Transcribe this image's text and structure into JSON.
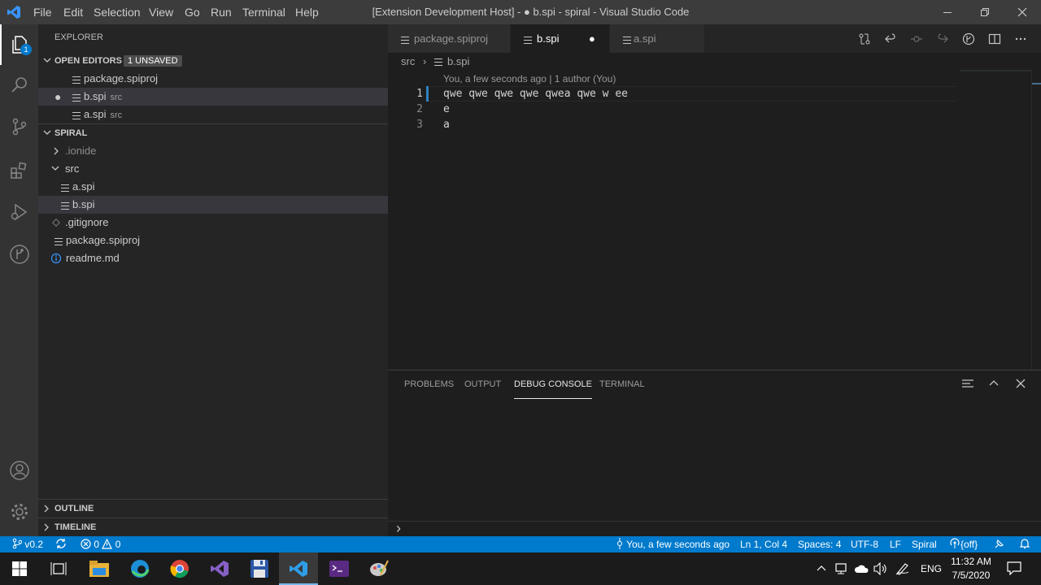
{
  "titlebar": {
    "menu": [
      "File",
      "Edit",
      "Selection",
      "View",
      "Go",
      "Run",
      "Terminal",
      "Help"
    ],
    "title": "[Extension Development Host] - ● b.spi - spiral - Visual Studio Code"
  },
  "activity": {
    "explorer_badge": "1"
  },
  "sidebar": {
    "title": "EXPLORER",
    "open_editors": {
      "label": "OPEN EDITORS",
      "badge": "1 UNSAVED",
      "items": [
        {
          "name": "package.spiproj",
          "desc": ""
        },
        {
          "name": "b.spi",
          "desc": "src",
          "dirty": "●"
        },
        {
          "name": "a.spi",
          "desc": "src"
        }
      ]
    },
    "folder": {
      "label": "SPIRAL",
      "items": [
        ".ionide",
        "src",
        "a.spi",
        "b.spi",
        ".gitignore",
        "package.spiproj",
        "readme.md"
      ]
    },
    "outline": "OUTLINE",
    "timeline": "TIMELINE"
  },
  "tabs": [
    {
      "label": "package.spiproj"
    },
    {
      "label": "b.spi",
      "dirty": "●"
    },
    {
      "label": "a.spi"
    }
  ],
  "editor": {
    "breadcrumb": {
      "folder": "src",
      "file": "b.spi"
    },
    "codelens": "You, a few seconds ago | 1 author (You)",
    "lines": [
      {
        "num": "1",
        "text": "qwe qwe qwe qwe qwea qwe w ee"
      },
      {
        "num": "2",
        "text": "e"
      },
      {
        "num": "3",
        "text": "a"
      }
    ]
  },
  "panel": {
    "tabs": [
      "PROBLEMS",
      "OUTPUT",
      "DEBUG CONSOLE",
      "TERMINAL"
    ],
    "active": "DEBUG CONSOLE",
    "prompt": "›"
  },
  "statusbar": {
    "branch": "v0.2",
    "errors": "0",
    "warnings": "0",
    "blame": "You, a few seconds ago",
    "position": "Ln 1, Col 4",
    "spaces": "Spaces: 4",
    "encoding": "UTF-8",
    "eol": "LF",
    "language": "Spiral",
    "live": "{off}"
  },
  "taskbar": {
    "lang": "ENG",
    "time": "11:32 AM",
    "date": "7/5/2020"
  },
  "colors": {
    "accent": "#007acc",
    "activity": "#333333",
    "sidebar": "#252526",
    "editor": "#1e1e1e"
  }
}
